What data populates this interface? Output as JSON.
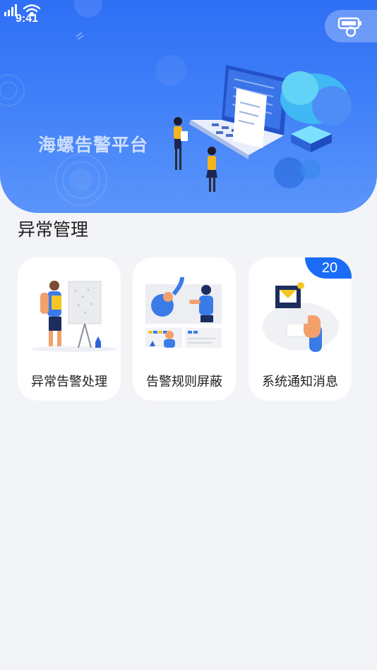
{
  "status_bar": {
    "time": "9:41"
  },
  "banner": {
    "title": "海螺告警平台"
  },
  "section": {
    "title": "异常管理"
  },
  "cards": [
    {
      "label": "异常告警处理",
      "icon": "presentation-person-illustration"
    },
    {
      "label": "告警规则屏蔽",
      "icon": "team-meeting-illustration"
    },
    {
      "label": "系统通知消息",
      "icon": "notification-envelope-illustration",
      "badge": "20"
    }
  ],
  "colors": {
    "accent": "#1a6cf5",
    "banner_top": "#2f6ff5",
    "banner_bottom": "#5b95fb",
    "background": "#f3f4f7"
  }
}
